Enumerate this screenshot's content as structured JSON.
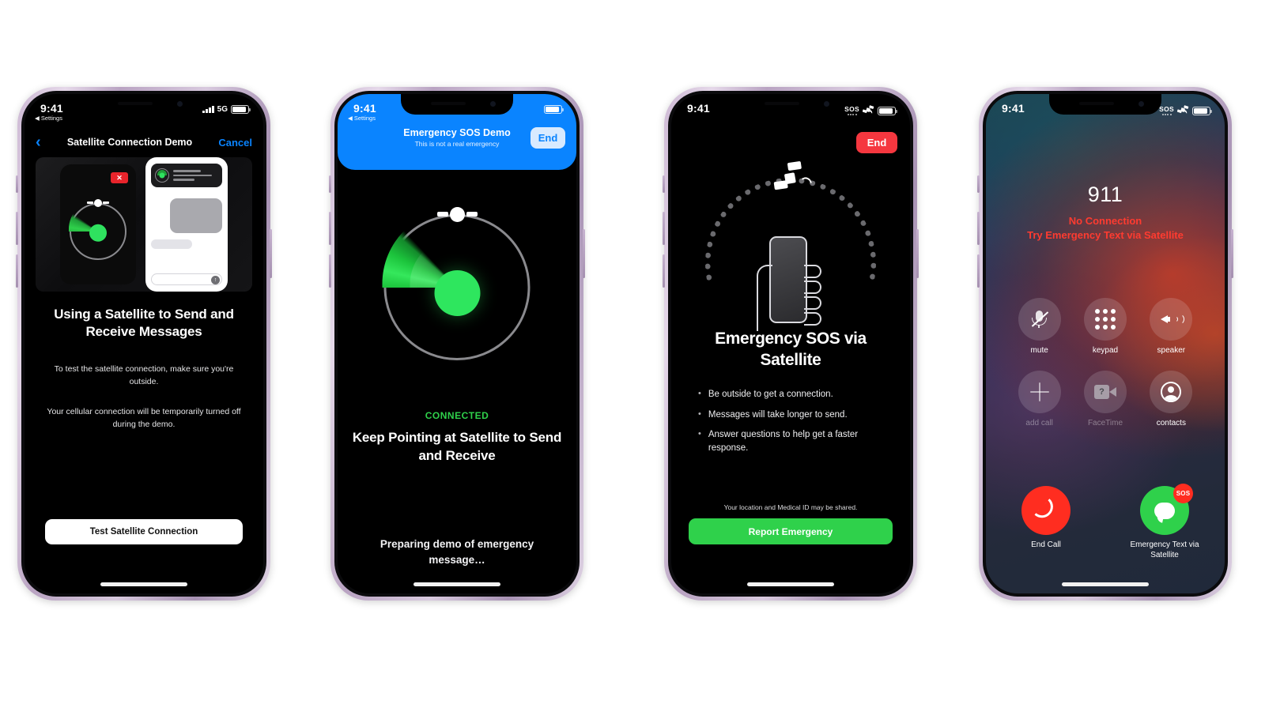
{
  "page": {
    "title": "Emergency SOS via Satellite — iPhone screens",
    "background_color": "#ffffff",
    "frame_color": "#c9b5d2"
  },
  "phones": [
    {
      "id": "satellite-connection-demo",
      "status_bar": {
        "time": "9:41",
        "back_label": "Settings",
        "signal_icon": "cellular-signal-icon",
        "network": "5G",
        "battery_icon": "battery-icon"
      },
      "nav": {
        "back_icon": "chevron-left-icon",
        "title": "Satellite Connection Demo",
        "cancel_label": "Cancel",
        "accent_color": "#0a84ff"
      },
      "hero": {
        "left_card_icon": "satellite-radar-icon",
        "close_badge_icon": "close-x-icon",
        "right_card_icon": "messages-preview-icon"
      },
      "heading": "Using a Satellite to Send and Receive Messages",
      "paragraph_1": "To test the satellite connection, make sure you're outside.",
      "paragraph_2": "Your cellular connection will be temporarily turned off during the demo.",
      "cta_label": "Test Satellite Connection"
    },
    {
      "id": "emergency-sos-demo",
      "status_bar": {
        "time": "9:41",
        "back_label": "Settings",
        "battery_icon": "battery-icon"
      },
      "banner": {
        "title": "Emergency SOS Demo",
        "subtitle": "This is not a real emergency",
        "end_label": "End",
        "color": "#0a84ff"
      },
      "dial_icon": "satellite-pointing-dial-icon",
      "status_label": "CONNECTED",
      "status_color": "#2fd14b",
      "heading": "Keep Pointing at Satellite to Send and Receive",
      "footer": "Preparing demo of emergency message…"
    },
    {
      "id": "emergency-sos-via-satellite",
      "status_bar": {
        "time": "9:41",
        "location_icon": "location-arrow-icon",
        "sos_label": "SOS",
        "satellite_icon": "satellite-icon",
        "battery_icon": "battery-icon"
      },
      "end_label": "End",
      "art_icon": "hand-holding-phone-satellite-arc-icon",
      "heading": "Emergency SOS via Satellite",
      "bullets": [
        "Be outside to get a connection.",
        "Messages will take longer to send.",
        "Answer questions to help get a faster response."
      ],
      "note": "Your location and Medical ID may be shared.",
      "cta_label": "Report Emergency",
      "cta_color": "#2fd14b"
    },
    {
      "id": "emergency-call-911",
      "status_bar": {
        "time": "9:41",
        "sos_label": "SOS",
        "satellite_icon": "satellite-icon",
        "battery_icon": "battery-icon"
      },
      "number": "911",
      "status_line_1": "No Connection",
      "status_line_2": "Try Emergency Text via Satellite",
      "status_color": "#ff3b30",
      "call_controls": [
        {
          "label": "mute",
          "icon": "mic-off-icon",
          "dimmed": false
        },
        {
          "label": "keypad",
          "icon": "keypad-icon",
          "dimmed": false
        },
        {
          "label": "speaker",
          "icon": "speaker-icon",
          "dimmed": false
        },
        {
          "label": "add call",
          "icon": "plus-icon",
          "dimmed": true
        },
        {
          "label": "FaceTime",
          "icon": "facetime-video-icon",
          "dimmed": true
        },
        {
          "label": "contacts",
          "icon": "contacts-icon",
          "dimmed": false
        }
      ],
      "end_call": {
        "label": "End Call",
        "icon": "end-call-handset-icon",
        "color": "#ff2d20"
      },
      "sos_message": {
        "label": "Emergency Text via Satellite",
        "icon": "messages-icon",
        "badge": "SOS",
        "color": "#2fd14b"
      }
    }
  ]
}
